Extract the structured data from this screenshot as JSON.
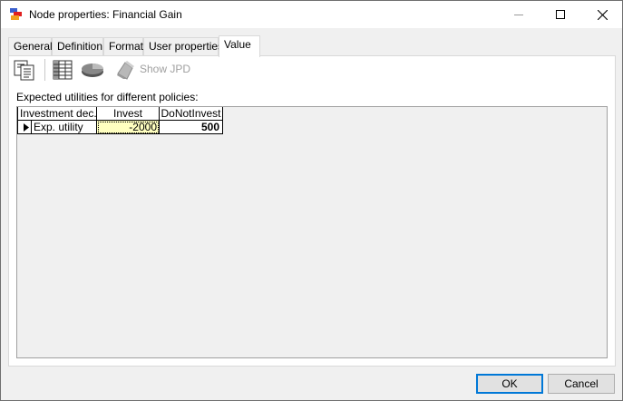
{
  "window": {
    "title": "Node properties: Financial Gain"
  },
  "tabs": [
    {
      "label": "General"
    },
    {
      "label": "Definition"
    },
    {
      "label": "Format"
    },
    {
      "label": "User properties"
    },
    {
      "label": "Value",
      "active": true
    }
  ],
  "toolbar": {
    "show_jpd_label": "Show JPD",
    "icons": [
      "copy-icon",
      "table-view-icon",
      "chart-view-icon",
      "show-jpd-icon"
    ]
  },
  "section": {
    "label": "Expected utilities for different policies:"
  },
  "grid": {
    "columns": [
      "Investment dec...",
      "Invest",
      "DoNotInvest"
    ],
    "rows": [
      {
        "label": "Exp. utility",
        "values": [
          "-2000",
          "500"
        ]
      }
    ],
    "highlight_color": "#ffffc0"
  },
  "buttons": {
    "ok": "OK",
    "cancel": "Cancel"
  }
}
